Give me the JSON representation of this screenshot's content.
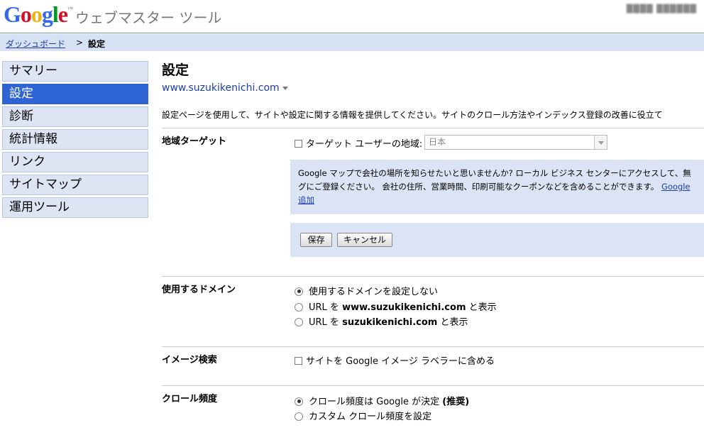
{
  "header": {
    "logo_letters": [
      "G",
      "o",
      "o",
      "g",
      "l",
      "e"
    ],
    "logo_colors": [
      "#3369e8",
      "#d50f25",
      "#eeb211",
      "#3369e8",
      "#009925",
      "#d50f25"
    ],
    "product": "ウェブマスター ツール",
    "user": "████ ██████"
  },
  "breadcrumb": {
    "dashboard": "ダッシュボード",
    "separator": ">",
    "current": "設定"
  },
  "sidebar": {
    "items": [
      {
        "label": "サマリー",
        "active": false
      },
      {
        "label": "設定",
        "active": true
      },
      {
        "label": "診断",
        "active": false
      },
      {
        "label": "統計情報",
        "active": false
      },
      {
        "label": "リンク",
        "active": false
      },
      {
        "label": "サイトマップ",
        "active": false
      },
      {
        "label": "運用ツール",
        "active": false
      }
    ]
  },
  "main": {
    "title": "設定",
    "site": "www.suzukikenichi.com",
    "description": "設定ページを使用して、サイトや設定に関する情報を提供してください。サイトのクロール方法やインデックス登録の改善に役立て",
    "geo": {
      "label": "地域ターゲット",
      "checkbox_label": "ターゲット ユーザーの地域:",
      "select_value": "日本",
      "info_line1": "Google マップで会社の場所を知らせたいと思いませんか? ローカル ビジネス センターにアクセスして、無",
      "info_line2": "グにご登録ください。 会社の住所、営業時間、印刷可能なクーポンなどを含めることができます。",
      "info_link1": "Google",
      "info_link2": "追加",
      "save": "保存",
      "cancel": "キャンセル"
    },
    "domain": {
      "label": "使用するドメイン",
      "opt1": "使用するドメインを設定しない",
      "opt2_pre": "URL を",
      "opt2_domain": "www.suzukikenichi.com",
      "opt2_post": "と表示",
      "opt3_pre": "URL を",
      "opt3_domain": "suzukikenichi.com",
      "opt3_post": "と表示"
    },
    "image": {
      "label": "イメージ検索",
      "checkbox_label": "サイトを Google イメージ ラベラーに含める"
    },
    "crawl": {
      "label": "クロール頻度",
      "opt1": "クロール頻度は Google が決定",
      "opt1_bold": "(推奨)",
      "opt2": "カスタム クロール頻度を設定"
    }
  }
}
